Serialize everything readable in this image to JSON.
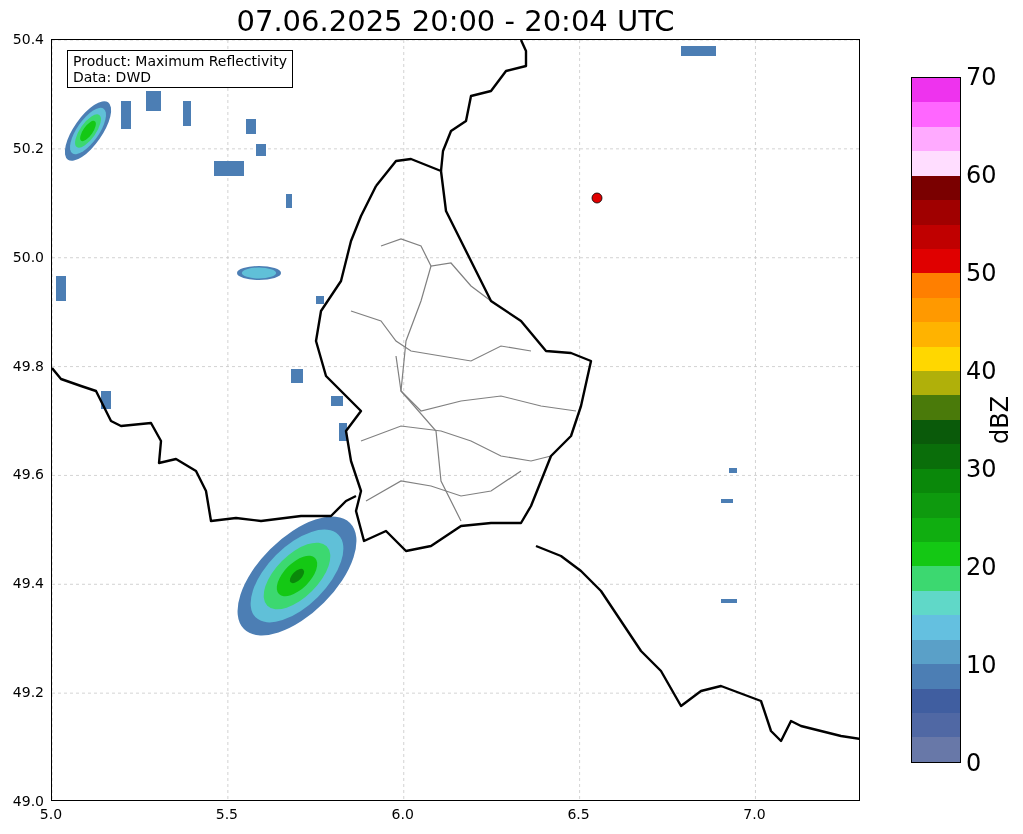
{
  "title": "07.06.2025 20:00 - 20:04 UTC",
  "legend": [
    "Product: Maximum Reflectivity",
    "Data: DWD"
  ],
  "map": {
    "x_ticks": [
      "5.0",
      "5.5",
      "6.0",
      "6.5",
      "7.0"
    ],
    "y_ticks": [
      "50.4",
      "50.2",
      "50.0",
      "49.8",
      "49.6",
      "49.4",
      "49.2",
      "49.0"
    ]
  },
  "colorbar": {
    "label": "dBZ",
    "ticks": [
      "70",
      "60",
      "50",
      "40",
      "30",
      "20",
      "10",
      "0"
    ],
    "bands": [
      {
        "color": "#ee33ee"
      },
      {
        "color": "#ff66ff"
      },
      {
        "color": "#ffaaff"
      },
      {
        "color": "#ffddff"
      },
      {
        "color": "#7a0000"
      },
      {
        "color": "#a00000"
      },
      {
        "color": "#c00000"
      },
      {
        "color": "#e00000"
      },
      {
        "color": "#ff7f00"
      },
      {
        "color": "#ff9900"
      },
      {
        "color": "#ffb300"
      },
      {
        "color": "#ffd700"
      },
      {
        "color": "#b0b00a"
      },
      {
        "color": "#4a7a0a"
      },
      {
        "color": "#0a5a0a"
      },
      {
        "color": "#0a6e0a"
      },
      {
        "color": "#0a880a"
      },
      {
        "color": "#0e9a0e"
      },
      {
        "color": "#10ae10"
      },
      {
        "color": "#14c814"
      },
      {
        "color": "#3cd870"
      },
      {
        "color": "#60d8c8"
      },
      {
        "color": "#64c0e0"
      },
      {
        "color": "#5aa0c8"
      },
      {
        "color": "#4c7eb4"
      },
      {
        "color": "#405ea0"
      },
      {
        "color": "#5068a4"
      },
      {
        "color": "#6878a8"
      }
    ]
  }
}
